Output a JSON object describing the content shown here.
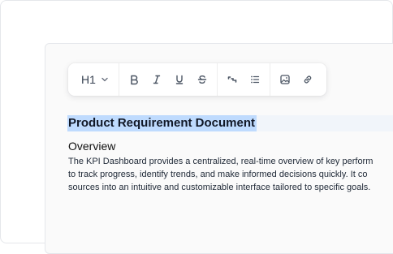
{
  "toolbar": {
    "heading_select": {
      "value": "H1",
      "icon": "chevron-down-icon"
    },
    "buttons": [
      {
        "name": "bold",
        "icon": "bold-icon"
      },
      {
        "name": "italic",
        "icon": "italic-icon"
      },
      {
        "name": "underline",
        "icon": "underline-icon"
      },
      {
        "name": "strikethrough",
        "icon": "strikethrough-icon"
      },
      {
        "name": "code-block",
        "icon": "code-block-icon"
      },
      {
        "name": "bullet-list",
        "icon": "bullet-list-icon"
      },
      {
        "name": "image",
        "icon": "image-icon"
      },
      {
        "name": "link",
        "icon": "link-icon"
      }
    ]
  },
  "document": {
    "title": "Product Requirement Document",
    "section_heading": "Overview",
    "paragraph_lines": [
      "The KPI Dashboard provides a centralized, real-time overview of key perform",
      "to track progress, identify trends, and make informed decisions quickly. It co",
      "sources into an intuitive and customizable interface tailored to specific goals."
    ]
  },
  "colors": {
    "selection_highlight": "#bfdbfe",
    "icon": "#4b5563"
  }
}
